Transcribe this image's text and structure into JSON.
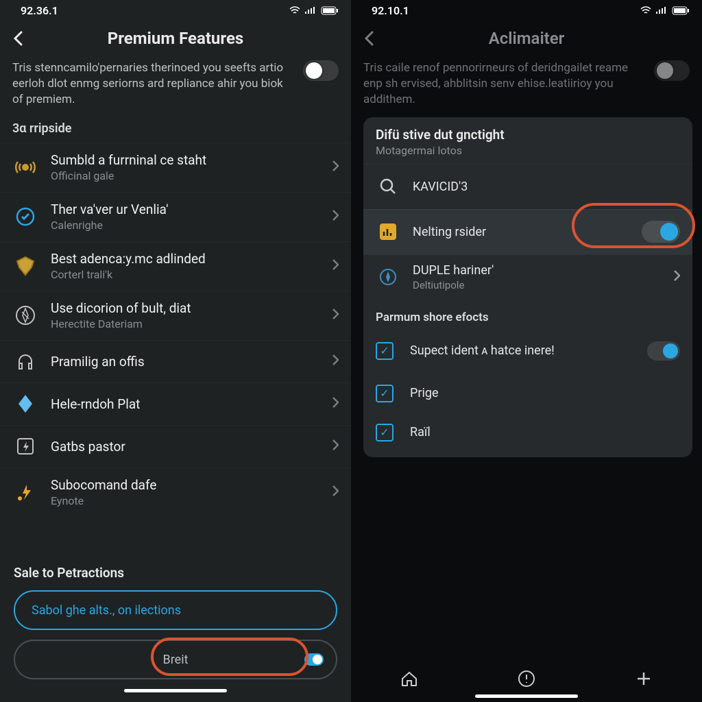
{
  "left": {
    "status_time": "92.36.1",
    "header_title": "Premium Features",
    "desc_text": "Tris stenncamilo'pernaries therinoed you seefts artio eerloh dlot enmg seriorns ard repliance ahir you biok of premiem.",
    "section_label": "3α rripside",
    "rows": [
      {
        "title": "Sumbld a furrninal ce staht",
        "subtitle": "Officinal gale",
        "icon": "broadcast-icon"
      },
      {
        "title": "Ther va'ver ur Venlia'",
        "subtitle": "Calenrighe",
        "icon": "check-circle-icon"
      },
      {
        "title": "Best adenca:y.mc adlinded",
        "subtitle": "Corterl trali'k",
        "icon": "shield-icon"
      },
      {
        "title": "Use dicorion of bult, diat",
        "subtitle": "Herectite Dateriam",
        "icon": "compass-icon"
      },
      {
        "title": "Pramilig an offis",
        "subtitle": "",
        "icon": "headset-icon"
      },
      {
        "title": "Hele-rndoh Plat",
        "subtitle": "",
        "icon": "diamond-icon"
      },
      {
        "title": "Gatbs pastor",
        "subtitle": "",
        "icon": "bolt-square-icon"
      },
      {
        "title": "Subocomand dafe",
        "subtitle": "Eynote",
        "icon": "spark-icon"
      }
    ],
    "footer_label": "Sale to Petractions",
    "pill_primary": "Sabol ghe alts., on ilections",
    "pill_secondary": "Breit"
  },
  "right": {
    "status_time": "92.10.1",
    "header_title": "Aclimaiter",
    "desc_text": "Tris caile renof pennorirneurs of deridngailet reame enp sh ervised, ahblitsin senv ehise.leatiirioy you addithem.",
    "card": {
      "title": "Difü stive dut gnctight",
      "subtitle": "Motagermai lotos",
      "search_row": "KAVICID'3",
      "toggle_row": "Nelting rsider",
      "nav_row_title": "DUPLE hariner'",
      "nav_row_sub": "Deltiutipole",
      "section": "Parmum shore efocts",
      "checks": [
        {
          "label": "Supect ident ᴀ hatce inere!"
        },
        {
          "label": "Prige"
        },
        {
          "label": "Raïl"
        }
      ]
    }
  }
}
